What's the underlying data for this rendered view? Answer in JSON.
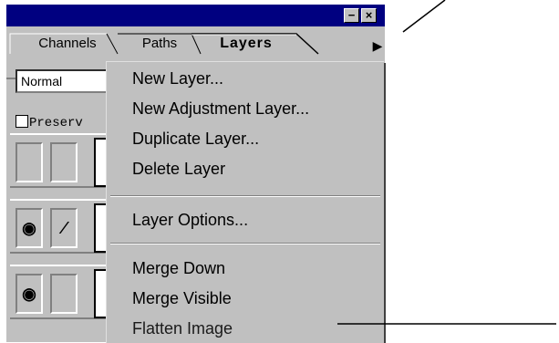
{
  "panel": {
    "tabs": [
      "Channels",
      "Paths",
      "Layers"
    ],
    "active_tab": "Layers",
    "title_buttons": {
      "minimize": "−",
      "close": "×"
    },
    "flyout_icon": "right-triangle-icon",
    "blend_mode": "Normal",
    "preserve_label": "Preserv"
  },
  "menu": {
    "items": [
      "New Layer...",
      "New Adjustment Layer...",
      "Duplicate Layer...",
      "Delete Layer",
      "Layer Options...",
      "Merge Down",
      "Merge Visible",
      "Flatten Image"
    ]
  },
  "colors": {
    "titlebar": "#000080",
    "face": "#c0c0c0"
  }
}
